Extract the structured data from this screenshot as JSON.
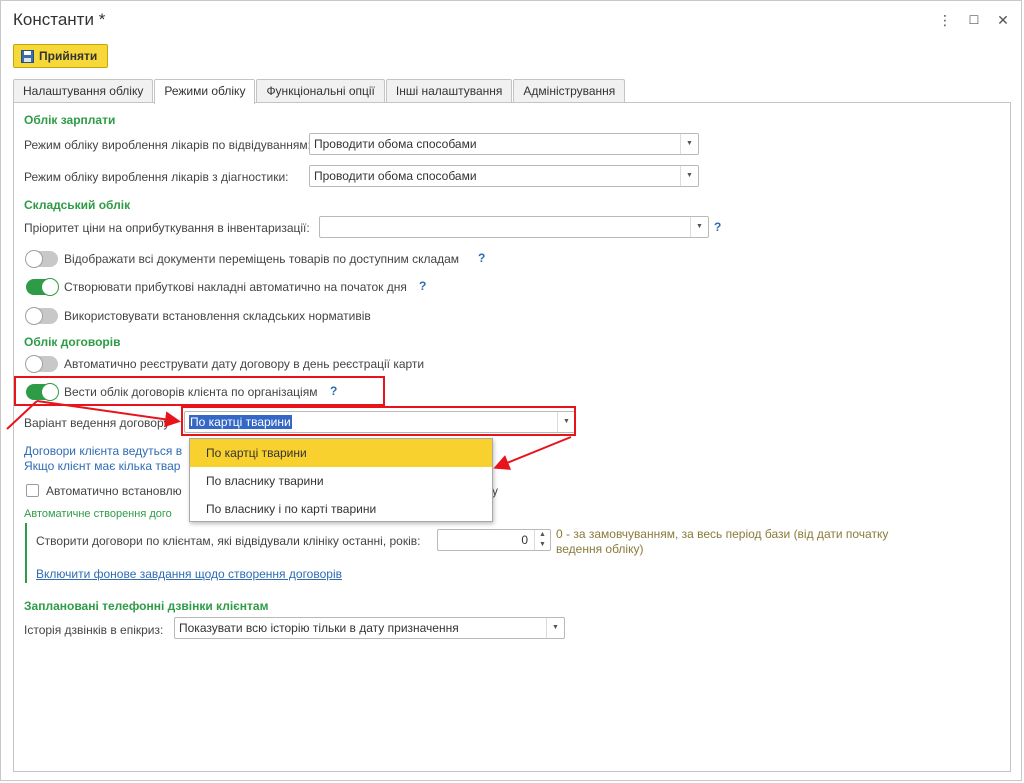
{
  "window": {
    "title": "Константи *",
    "menu_icon": "⋮",
    "maximize_icon": "☐",
    "close_icon": "✕"
  },
  "toolbar": {
    "accept_label": "Прийняти"
  },
  "tabs": [
    {
      "label": "Налаштування обліку",
      "active": false
    },
    {
      "label": "Режими обліку",
      "active": true
    },
    {
      "label": "Функціональні опції",
      "active": false
    },
    {
      "label": "Інші налаштування",
      "active": false
    },
    {
      "label": "Адміністрування",
      "active": false
    }
  ],
  "salary": {
    "title": "Облік зарплати",
    "visits_label": "Режим обліку вироблення лікарів по відвідуванням:",
    "visits_value": "Проводити обома способами",
    "diag_label": "Режим обліку вироблення лікарів з діагностики:",
    "diag_value": "Проводити обома способами"
  },
  "warehouse": {
    "title": "Складський облік",
    "priority_label": "Пріоритет ціни на оприбуткування в інвентаризації:",
    "priority_value": "",
    "help": "?",
    "toggle1_label": "Відображати всі документи переміщень товарів по доступним складам",
    "toggle2_label": "Створювати прибуткові накладні автоматично на початок дня",
    "toggle3_label": "Використовувати встановлення складських нормативів"
  },
  "contracts": {
    "title": "Облік договорів",
    "toggle1_label": "Автоматично реєструвати дату договору в день реєстрації карти",
    "toggle2_label": "Вести облік договорів клієнта по організаціям",
    "variant_label": "Варіант ведення договору",
    "variant_value": "По картці тварини",
    "info_line1": "Договори клієнта ведуться в",
    "info_line2": "Якщо клієнт має кілька твар",
    "auto_set_label": "Автоматично встановлю",
    "auto_set_tail": "у",
    "auto_create_title": "Автоматичне створення дого",
    "create_label": "Створити договори по клієнтам, які відвідували клініку останні, років:",
    "create_value": "0",
    "create_note": "0 - за замовчуванням, за весь період бази (від дати початку ведення обліку)",
    "bg_task_link": "Включити фонове завдання щодо створення договорів"
  },
  "dropdown": {
    "options": [
      "По картці тварини",
      "По власнику тварини",
      "По власнику і по карті тварини"
    ],
    "selected_index": 0
  },
  "calls": {
    "title": "Заплановані телефонні дзвінки клієнтам",
    "history_label": "Історія дзвінків в епікриз:",
    "history_value": "Показувати всю історію тільки в дату призначення"
  },
  "colors": {
    "section_green": "#2e9c47",
    "accept_yellow": "#f7d83a",
    "annotation_red": "#e8141b",
    "link_blue": "#2f6bb3"
  }
}
